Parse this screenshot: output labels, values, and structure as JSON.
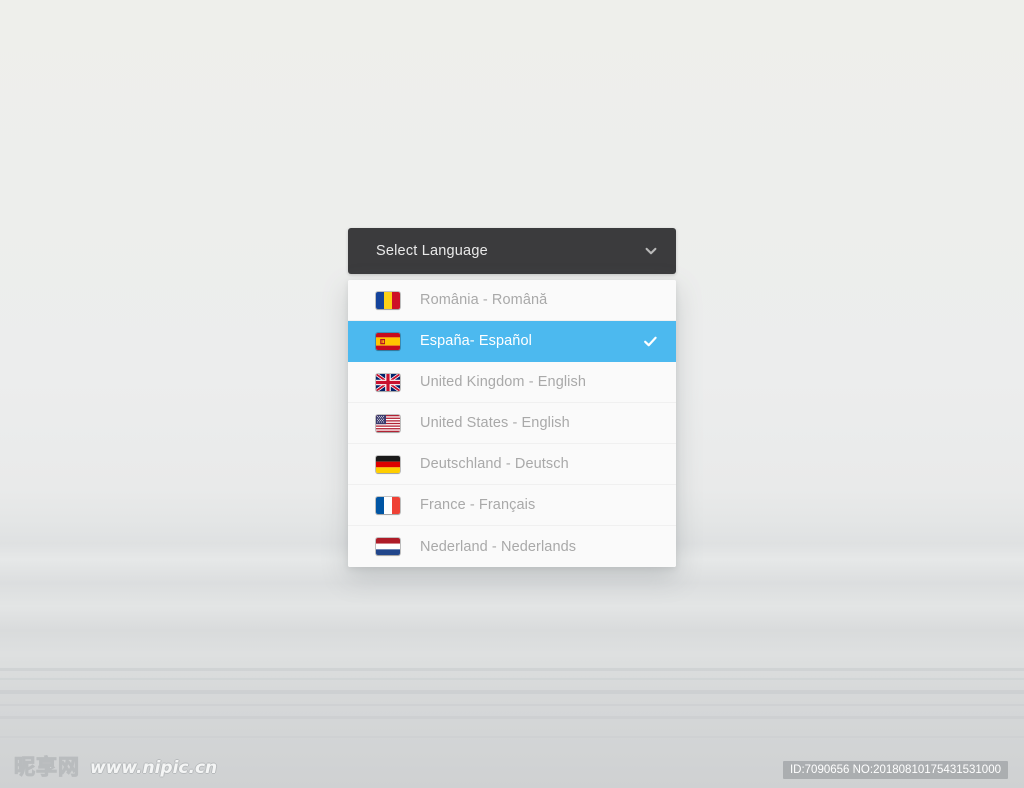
{
  "watermark": {
    "logo_text": "昵享网",
    "url_text": "www.nipic.cn",
    "id_badge": "ID:7090656 NO:20180810175431531000"
  },
  "colors": {
    "header_bg": "#3b3b3d",
    "header_text": "#e9e9e9",
    "list_bg": "#fafafa",
    "option_text": "#a9a9a9",
    "selected_bg": "#4cb9ef",
    "selected_text": "#ffffff",
    "page_bg_top": "#edeeea",
    "page_bg_bottom": "#cfd1d2"
  },
  "select": {
    "header_label": "Select Language",
    "chevron_icon": "chevron-down-icon",
    "selected_index": 1,
    "options": [
      {
        "label": "România - Română",
        "flag_icon": "flag-romania-icon",
        "flag_code": "ro",
        "selected": false,
        "check_icon": "check-icon"
      },
      {
        "label": "España- Español",
        "flag_icon": "flag-spain-icon",
        "flag_code": "es",
        "selected": true,
        "check_icon": "check-icon"
      },
      {
        "label": "United Kingdom - English",
        "flag_icon": "flag-united-kingdom-icon",
        "flag_code": "gb",
        "selected": false,
        "check_icon": "check-icon"
      },
      {
        "label": "United States - English",
        "flag_icon": "flag-united-states-icon",
        "flag_code": "us",
        "selected": false,
        "check_icon": "check-icon"
      },
      {
        "label": "Deutschland - Deutsch",
        "flag_icon": "flag-germany-icon",
        "flag_code": "de",
        "selected": false,
        "check_icon": "check-icon"
      },
      {
        "label": "France - Français",
        "flag_icon": "flag-france-icon",
        "flag_code": "fr",
        "selected": false,
        "check_icon": "check-icon"
      },
      {
        "label": "Nederland - Nederlands",
        "flag_icon": "flag-netherlands-icon",
        "flag_code": "nl",
        "selected": false,
        "check_icon": "check-icon"
      }
    ]
  }
}
